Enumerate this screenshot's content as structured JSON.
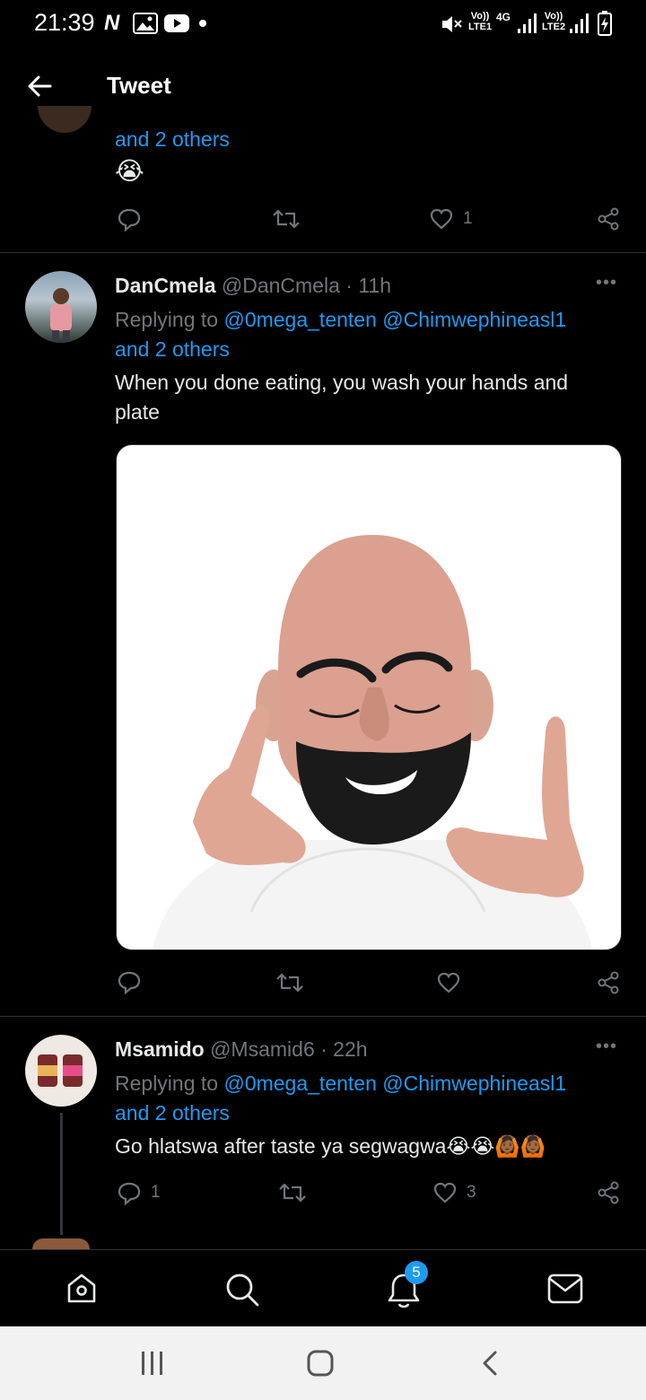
{
  "status_bar": {
    "time": "21:39",
    "net1": "Vo))\nLTE1",
    "net_gen": "4G",
    "net2": "Vo))\nLTE2"
  },
  "header": {
    "title": "Tweet"
  },
  "tweet0": {
    "mention_more": "and 2 others",
    "text": "😭",
    "like_count": "1"
  },
  "tweet1": {
    "name": "DanCmela",
    "handle": "@DanCmela",
    "time": "· 11h",
    "replying_prefix": "Replying to",
    "mention1": "@0mega_tenten",
    "mention2": "@Chimwephineasl1",
    "mention_more": "and 2 others",
    "text": "When you done eating, you wash your hands and plate"
  },
  "tweet2": {
    "name": "Msamido",
    "handle": "@Msamid6",
    "time": "· 22h",
    "replying_prefix": "Replying to",
    "mention1": "@0mega_tenten",
    "mention2": "@Chimwephineasl1",
    "mention_more": "and 2 others",
    "text": "Go hlatswa after taste ya segwagwa😭😭🙆🏾🙆🏾",
    "reply_count": "1",
    "like_count": "3"
  },
  "nav": {
    "notifications_badge": "5"
  },
  "colors": {
    "accent": "#1d9bf0",
    "muted": "#71767b",
    "background": "#000000"
  }
}
